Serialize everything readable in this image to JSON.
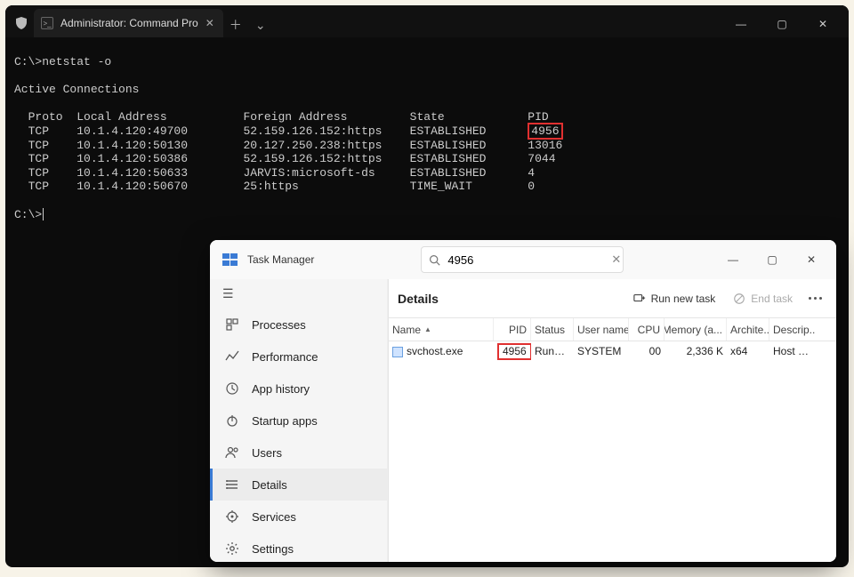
{
  "terminal": {
    "tab_title": "Administrator: Command Pro",
    "prompt1": "C:\\>",
    "command": "netstat -o",
    "active_heading": "Active Connections",
    "columns": {
      "proto": "Proto",
      "local": "Local Address",
      "foreign": "Foreign Address",
      "state": "State",
      "pid": "PID"
    },
    "rows": [
      {
        "proto": "TCP",
        "local": "10.1.4.120:49700",
        "foreign": "52.159.126.152:https",
        "state": "ESTABLISHED",
        "pid": "4956",
        "hl": true
      },
      {
        "proto": "TCP",
        "local": "10.1.4.120:50130",
        "foreign": "20.127.250.238:https",
        "state": "ESTABLISHED",
        "pid": "13016"
      },
      {
        "proto": "TCP",
        "local": "10.1.4.120:50386",
        "foreign": "52.159.126.152:https",
        "state": "ESTABLISHED",
        "pid": "7044"
      },
      {
        "proto": "TCP",
        "local": "10.1.4.120:50633",
        "foreign": "JARVIS:microsoft-ds",
        "state": "ESTABLISHED",
        "pid": "4"
      },
      {
        "proto": "TCP",
        "local": "10.1.4.120:50670",
        "foreign": "25:https",
        "state": "TIME_WAIT",
        "pid": "0"
      }
    ],
    "prompt2": "C:\\>"
  },
  "taskmgr": {
    "title": "Task Manager",
    "search_value": "4956",
    "heading": "Details",
    "run_new_task": "Run new task",
    "end_task": "End task",
    "sidebar": [
      {
        "id": "processes",
        "label": "Processes"
      },
      {
        "id": "performance",
        "label": "Performance"
      },
      {
        "id": "apphistory",
        "label": "App history"
      },
      {
        "id": "startup",
        "label": "Startup apps"
      },
      {
        "id": "users",
        "label": "Users"
      },
      {
        "id": "details",
        "label": "Details"
      },
      {
        "id": "services",
        "label": "Services"
      }
    ],
    "settings_label": "Settings",
    "columns": {
      "name": "Name",
      "pid": "PID",
      "status": "Status",
      "user": "User name",
      "cpu": "CPU",
      "mem": "Memory (a...",
      "arch": "Archite...",
      "desc": "Descrip..."
    },
    "rows": [
      {
        "name": "svchost.exe",
        "pid": "4956",
        "status": "Running",
        "user": "SYSTEM",
        "cpu": "00",
        "mem": "2,336 K",
        "arch": "x64",
        "desc": "Host Pr..."
      }
    ]
  }
}
